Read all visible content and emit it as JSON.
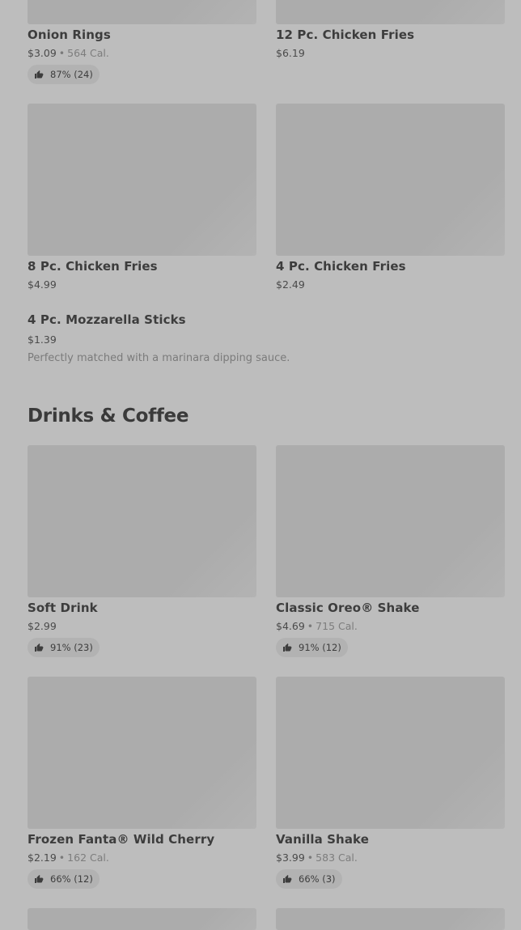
{
  "items": [
    {
      "key": "onion",
      "name": "Onion Rings",
      "price": "$3.09",
      "calories": "564 Cal.",
      "rating": "87% (24)"
    },
    {
      "key": "cf12",
      "name": "12 Pc. Chicken Fries",
      "price": "$6.19"
    },
    {
      "key": "cf8",
      "name": "8 Pc. Chicken Fries",
      "price": "$4.99"
    },
    {
      "key": "cf4",
      "name": "4 Pc. Chicken Fries",
      "price": "$2.49"
    },
    {
      "key": "mozz",
      "name": "4 Pc. Mozzarella Sticks",
      "price": "$1.39",
      "description": "Perfectly matched with a marinara dipping sauce."
    }
  ],
  "drinks_section": {
    "title": "Drinks & Coffee"
  },
  "drinks": [
    {
      "name": "Soft Drink",
      "price": "$2.99",
      "rating": "91% (23)"
    },
    {
      "name": "Classic Oreo® Shake",
      "price": "$4.69",
      "calories": "715 Cal.",
      "rating": "91% (12)"
    },
    {
      "name": "Frozen Fanta® Wild Cherry",
      "price": "$2.19",
      "calories": "162 Cal.",
      "rating": "66% (12)"
    },
    {
      "name": "Vanilla Shake",
      "price": "$3.99",
      "calories": "583 Cal.",
      "rating": "66% (3)"
    }
  ],
  "separator": "•",
  "icons": {
    "rating": "thumbs-up-icon"
  },
  "colors": {
    "page_bg": "#bdbdbd",
    "image_placeholder": "#acacac",
    "badge_bg": "#b2b2b2"
  }
}
